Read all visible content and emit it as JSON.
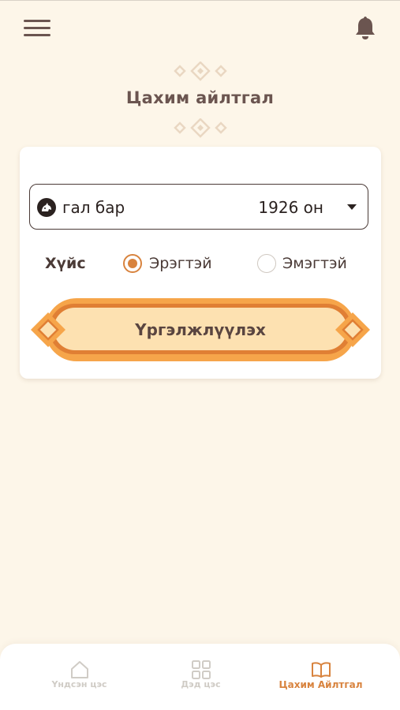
{
  "header": {
    "menu_icon": "hamburger-menu-icon",
    "notification_icon": "bell-icon"
  },
  "page": {
    "title": "Цахим айлтгал"
  },
  "form": {
    "selector": {
      "icon": "horse-icon",
      "name": "гал бар",
      "year": "1926 он",
      "caret_icon": "caret-down-icon"
    },
    "gender": {
      "label": "Хүйс",
      "options": [
        {
          "label": "Эрэгтэй",
          "selected": true
        },
        {
          "label": "Эмэгтэй",
          "selected": false
        }
      ]
    },
    "continue_label": "Үргэлжлүүлэх"
  },
  "bottom_nav": {
    "items": [
      {
        "label": "Үндсэн цэс",
        "icon": "home-icon",
        "active": false
      },
      {
        "label": "Дэд цэс",
        "icon": "grid-icon",
        "active": false
      },
      {
        "label": "Цахим Айлтгал",
        "icon": "book-icon",
        "active": true
      }
    ]
  },
  "colors": {
    "background": "#fdf6e9",
    "accent": "#d8833e",
    "text": "#5a4540",
    "inactive": "#d0ccc6"
  }
}
